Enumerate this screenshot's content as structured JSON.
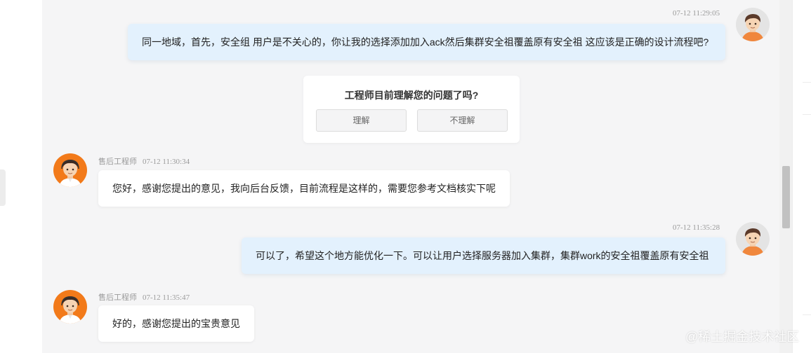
{
  "messages": [
    {
      "role": "user",
      "time": "07-12 11:29:05",
      "text": "同一地域，首先，安全组 用户是不关心的，你让我的选择添加加入ack然后集群安全祖覆盖原有安全祖 这应该是正确的设计流程吧?"
    },
    {
      "role": "agent",
      "sender": "售后工程师",
      "time": "07-12 11:30:34",
      "text": "您好，感谢您提出的意见，我向后台反馈，目前流程是这样的，需要您参考文档核实下呢"
    },
    {
      "role": "user",
      "time": "07-12 11:35:28",
      "text": "可以了，希望这个地方能优化一下。可以让用户选择服务器加入集群，集群work的安全祖覆盖原有安全祖"
    },
    {
      "role": "agent",
      "sender": "售后工程师",
      "time": "07-12 11:35:47",
      "text": "好的，感谢您提出的宝贵意见"
    }
  ],
  "survey": {
    "question": "工程师目前理解您的问题了吗?",
    "options": [
      "理解",
      "不理解"
    ]
  },
  "avatars": {
    "user_icon": "user-avatar-icon",
    "agent_icon": "engineer-avatar-icon",
    "user_background": "#e4e4e4",
    "agent_background": "#f27a1a"
  },
  "theme": {
    "user_bubble": "#e3f1fd",
    "agent_bubble": "#ffffff",
    "chat_background": "#f5f5f6",
    "muted_text": "#9a9a9a"
  },
  "watermark": "@稀土掘金技术社区"
}
